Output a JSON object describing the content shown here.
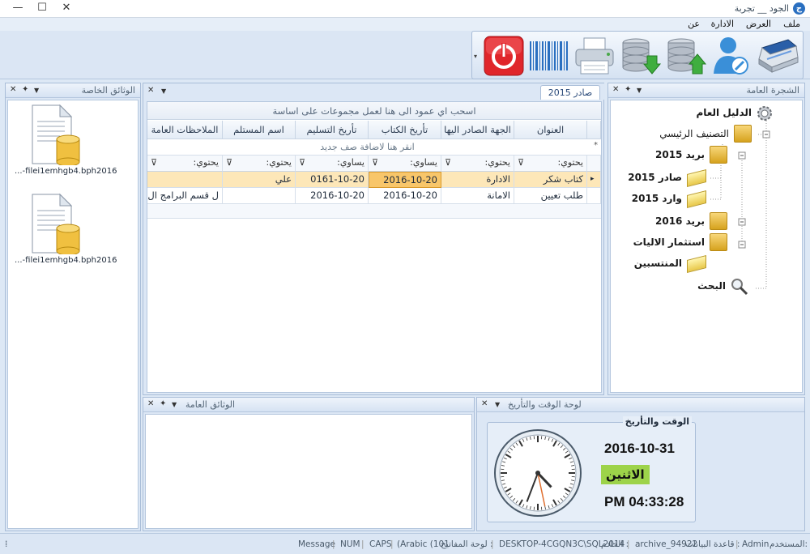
{
  "window": {
    "title": "الجود __ تجربة"
  },
  "menu": {
    "items": [
      "ملف",
      "العرض",
      "الادارة",
      "عن"
    ]
  },
  "toolbar": {
    "icons": [
      "scanner-icon",
      "add-user-icon",
      "upload-database-icon",
      "download-database-icon",
      "printer-icon",
      "barcode-icon",
      "power-icon"
    ]
  },
  "left_panel": {
    "title": "الوثائق الخاصة",
    "files": [
      {
        "name": "...-filei1emhgb4.bph2016"
      },
      {
        "name": "...-filei1emhgb4.bph2016"
      }
    ]
  },
  "center_panel": {
    "tab_label": "صادر 2015",
    "group_hint": "اسحب اي عمود الى هنا لعمل مجموعات على اساسة",
    "new_row_hint": "انقر هنا لاضافة صف جديد",
    "columns": [
      "العنوان",
      "الجهة الصادر اليها",
      "تأريخ الكتاب",
      "تأريخ التسليم",
      "اسم المستلم",
      "الملاحظات العامة"
    ],
    "filters": [
      "يحتوي:",
      "يحتوي:",
      "يساوي:",
      "يساوي:",
      "يحتوي:",
      "يحتوي:"
    ],
    "rows": [
      [
        "كتاب شكر",
        "الادارة",
        "2016-10-20",
        "0161-10-20",
        "علي",
        ""
      ],
      [
        "طلب تعيين",
        "الامانة",
        "2016-10-20",
        "2016-10-20",
        "",
        "ل قسم البرامج ال..."
      ]
    ]
  },
  "tree_panel": {
    "title": "الشجرة العامة",
    "nodes": [
      "الدليل العام",
      "التصنيف الرئيسي",
      "بريد 2015",
      "صادر 2015",
      "وارد 2015",
      "بريد 2016",
      "استثمار الاليات",
      "المنتسبين",
      "البحث"
    ]
  },
  "public_docs_panel": {
    "title": "الوثائق العامة"
  },
  "datetime_panel": {
    "title": "لوحة الوقت والتأريخ",
    "group_label": "الوقت والتأريخ",
    "date": "2016-10-31",
    "day": "الاثنين",
    "time": "PM 04:33:28",
    "clock": {
      "hour": 4,
      "minute": 33,
      "second": 28
    }
  },
  "status_bar": {
    "user_label": "المستخدم:",
    "user": "Admin",
    "db_label": "قاعدة البيانات :",
    "db": "archive_94922",
    "server_label": "الخادم :",
    "server": "DESKTOP-4CGQN3C\\SQL2014",
    "keyboard_label": "لوحة المفاتيح :",
    "keyboard": "(Arabic (101",
    "caps": "CAPS",
    "num": "NUM",
    "message": "Message"
  },
  "colors": {
    "selected_row": "#fde7b8",
    "day_badge": "#9dd34a",
    "power_red": "#e0262b",
    "chip_gold": "#e8b93a"
  }
}
